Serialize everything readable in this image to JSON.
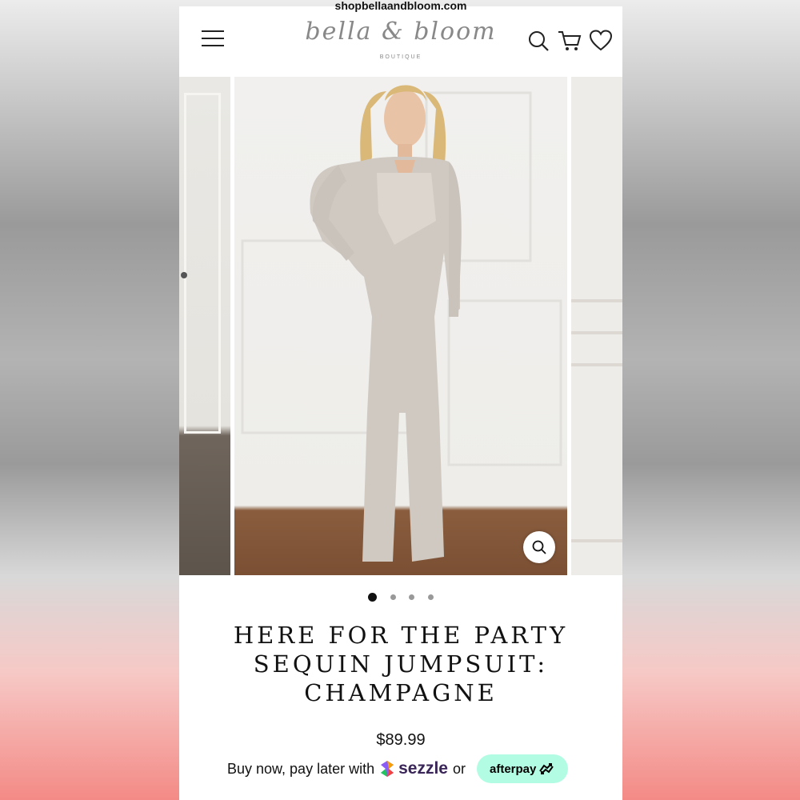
{
  "browser": {
    "url": "shopbellaandbloom.com"
  },
  "header": {
    "logo_script": "bella & bloom",
    "logo_sub": "BOUTIQUE",
    "icons": [
      "menu-icon",
      "search-icon",
      "cart-icon",
      "heart-icon"
    ]
  },
  "gallery": {
    "slide_count": 4,
    "active_index": 0,
    "zoom_icon": "magnifier-icon"
  },
  "product": {
    "title_lines": [
      "HERE FOR THE PARTY",
      "SEQUIN JUMPSUIT:",
      "CHAMPAGNE"
    ],
    "price": "$89.99"
  },
  "payment": {
    "intro": "Buy now, pay later with",
    "sezzle_label": "sezzle",
    "or_text": "or",
    "afterpay_label": "afterpay"
  },
  "colors": {
    "text": "#111111",
    "afterpay_bg": "#b2fce4",
    "sezzle_text": "#392558"
  }
}
